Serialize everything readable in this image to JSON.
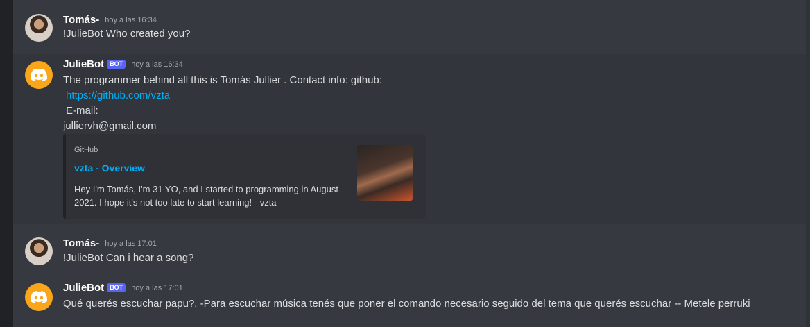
{
  "messages": [
    {
      "author": "Tomás-",
      "timestamp": "hoy a las 16:34",
      "text": "!JulieBot Who created you?"
    },
    {
      "author": "JulieBot",
      "bot_tag": "BOT",
      "timestamp": "hoy a las 16:34",
      "lines": [
        "The programmer behind all this is Tomás Jullier . Contact info: github:",
        "https://github.com/vzta",
        "E-mail:",
        "julliervh@gmail.com"
      ],
      "embed": {
        "provider": "GitHub",
        "title": "vzta - Overview",
        "description": "Hey I'm Tomás, I'm 31 YO, and I started to programming in August 2021. I hope it's not too late to start learning! - vzta"
      }
    },
    {
      "author": "Tomás-",
      "timestamp": "hoy a las 17:01",
      "text": "!JulieBot Can i hear a song?"
    },
    {
      "author": "JulieBot",
      "bot_tag": "BOT",
      "timestamp": "hoy a las 17:01",
      "text": "Qué querés escuchar papu?. -Para escuchar música tenés que poner el comando necesario seguido del tema que querés escuchar -- Metele perruki"
    }
  ],
  "colors": {
    "background": "#36393f",
    "link": "#00aff4",
    "bot_tag": "#5865f2",
    "bot_avatar": "#faa61a"
  },
  "icons": {
    "bot_avatar": "discord-logo-icon"
  }
}
